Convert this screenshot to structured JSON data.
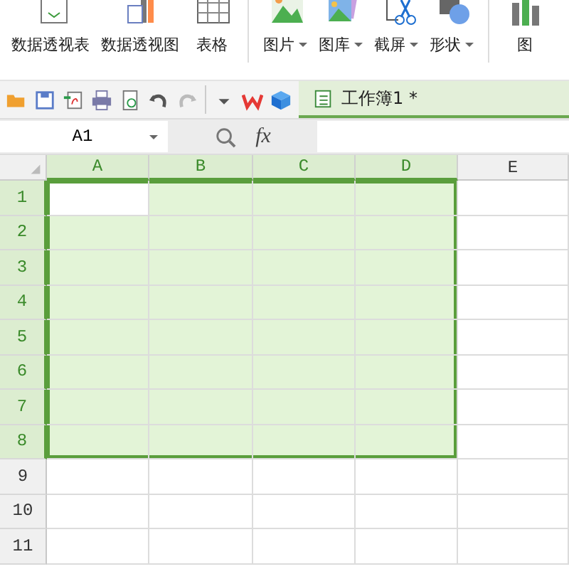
{
  "ribbon": {
    "groups": [
      [
        {
          "label": "数据透视表",
          "dropdown": false
        },
        {
          "label": "数据透视图",
          "dropdown": false
        },
        {
          "label": "表格",
          "dropdown": false
        }
      ],
      [
        {
          "label": "图片",
          "dropdown": true
        },
        {
          "label": "图库",
          "dropdown": true
        },
        {
          "label": "截屏",
          "dropdown": true
        },
        {
          "label": "形状",
          "dropdown": true
        }
      ],
      [
        {
          "label": "图",
          "dropdown": false
        }
      ]
    ]
  },
  "document_tab": {
    "title": "工作簿1 *",
    "selected": true
  },
  "name_box": {
    "value": "A1"
  },
  "formula_bar": {
    "fx": "fx"
  },
  "columns": [
    {
      "label": "A",
      "selected": true
    },
    {
      "label": "B",
      "selected": true
    },
    {
      "label": "C",
      "selected": true
    },
    {
      "label": "D",
      "selected": true
    },
    {
      "label": "E",
      "selected": false
    }
  ],
  "rows": [
    {
      "label": "1",
      "selected": true,
      "cells": [
        {
          "selected": true,
          "active": true
        },
        {
          "selected": true,
          "active": false
        },
        {
          "selected": true,
          "active": false
        },
        {
          "selected": true,
          "active": false
        },
        {
          "selected": false,
          "active": false
        }
      ]
    },
    {
      "label": "2",
      "selected": true,
      "cells": [
        {
          "selected": true,
          "active": false
        },
        {
          "selected": true,
          "active": false
        },
        {
          "selected": true,
          "active": false
        },
        {
          "selected": true,
          "active": false
        },
        {
          "selected": false,
          "active": false
        }
      ]
    },
    {
      "label": "3",
      "selected": true,
      "cells": [
        {
          "selected": true,
          "active": false
        },
        {
          "selected": true,
          "active": false
        },
        {
          "selected": true,
          "active": false
        },
        {
          "selected": true,
          "active": false
        },
        {
          "selected": false,
          "active": false
        }
      ]
    },
    {
      "label": "4",
      "selected": true,
      "cells": [
        {
          "selected": true,
          "active": false
        },
        {
          "selected": true,
          "active": false
        },
        {
          "selected": true,
          "active": false
        },
        {
          "selected": true,
          "active": false
        },
        {
          "selected": false,
          "active": false
        }
      ]
    },
    {
      "label": "5",
      "selected": true,
      "cells": [
        {
          "selected": true,
          "active": false
        },
        {
          "selected": true,
          "active": false
        },
        {
          "selected": true,
          "active": false
        },
        {
          "selected": true,
          "active": false
        },
        {
          "selected": false,
          "active": false
        }
      ]
    },
    {
      "label": "6",
      "selected": true,
      "cells": [
        {
          "selected": true,
          "active": false
        },
        {
          "selected": true,
          "active": false
        },
        {
          "selected": true,
          "active": false
        },
        {
          "selected": true,
          "active": false
        },
        {
          "selected": false,
          "active": false
        }
      ]
    },
    {
      "label": "7",
      "selected": true,
      "cells": [
        {
          "selected": true,
          "active": false
        },
        {
          "selected": true,
          "active": false
        },
        {
          "selected": true,
          "active": false
        },
        {
          "selected": true,
          "active": false
        },
        {
          "selected": false,
          "active": false
        }
      ]
    },
    {
      "label": "8",
      "selected": true,
      "cells": [
        {
          "selected": true,
          "active": false
        },
        {
          "selected": true,
          "active": false
        },
        {
          "selected": true,
          "active": false
        },
        {
          "selected": true,
          "active": false
        },
        {
          "selected": false,
          "active": false
        }
      ]
    },
    {
      "label": "9",
      "selected": false,
      "cells": [
        {
          "selected": false,
          "active": false
        },
        {
          "selected": false,
          "active": false
        },
        {
          "selected": false,
          "active": false
        },
        {
          "selected": false,
          "active": false
        },
        {
          "selected": false,
          "active": false
        }
      ]
    },
    {
      "label": "10",
      "selected": false,
      "cells": [
        {
          "selected": false,
          "active": false
        },
        {
          "selected": false,
          "active": false
        },
        {
          "selected": false,
          "active": false
        },
        {
          "selected": false,
          "active": false
        },
        {
          "selected": false,
          "active": false
        }
      ]
    },
    {
      "label": "11",
      "selected": false,
      "cells": [
        {
          "selected": false,
          "active": false
        },
        {
          "selected": false,
          "active": false
        },
        {
          "selected": false,
          "active": false
        },
        {
          "selected": false,
          "active": false
        },
        {
          "selected": false,
          "active": false
        }
      ]
    }
  ]
}
